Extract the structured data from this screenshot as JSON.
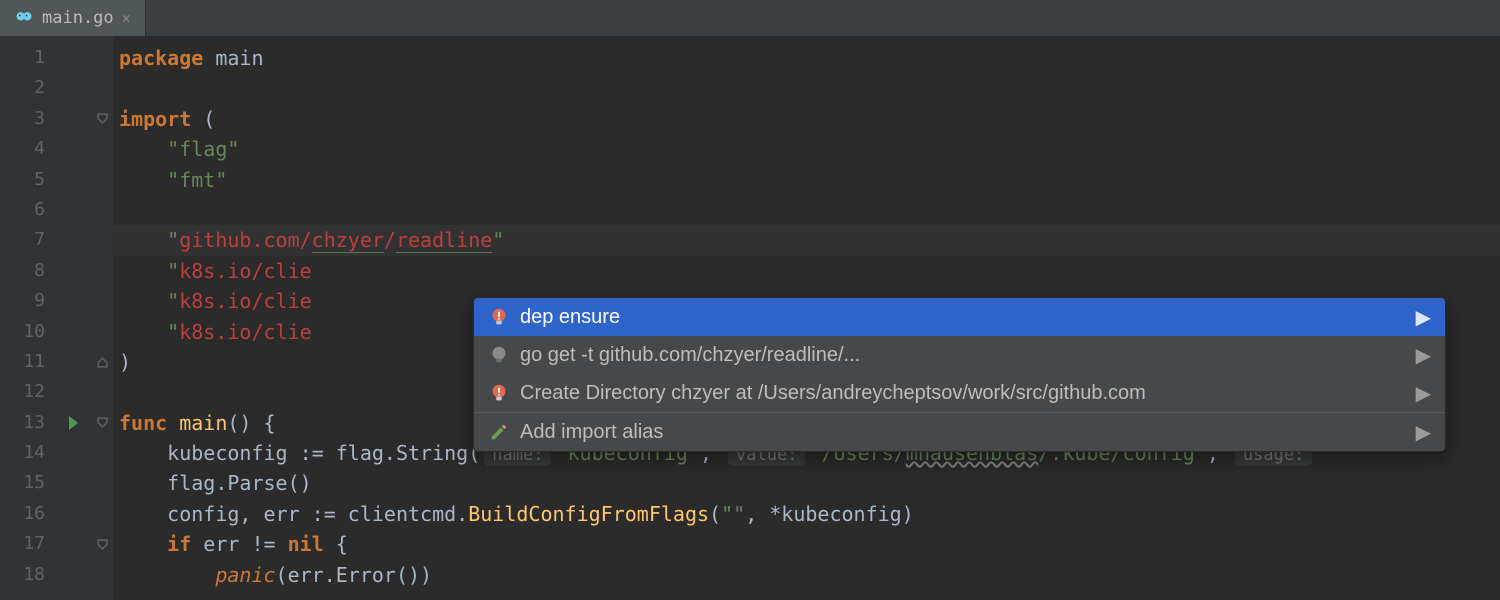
{
  "tab": {
    "filename": "main.go"
  },
  "gutter": {
    "start": 1,
    "end": 18
  },
  "run_marker_line": 13,
  "fold_markers": {
    "3": "open-top",
    "11": "open-bottom",
    "13": "open-top",
    "17": "open-top"
  },
  "bulb_line": 6,
  "highlighted_line": 7,
  "code": {
    "l1": {
      "pkg_kw": "package",
      "pkg_name": " main"
    },
    "l3": {
      "import_kw": "import",
      "paren": " ("
    },
    "l4": {
      "s": "\"flag\""
    },
    "l5": {
      "s": "\"fmt\""
    },
    "l7": {
      "q1": "\"",
      "p1": "github.com/",
      "p2": "chzyer",
      "slash": "/",
      "p3": "readline",
      "q2": "\""
    },
    "l8": {
      "q1": "\"",
      "a": "k8s.io/clie"
    },
    "l9": {
      "q1": "\"",
      "a": "k8s.io/clie"
    },
    "l10": {
      "q1": "\"",
      "a": "k8s.io/clie"
    },
    "l11": {
      "paren": ")"
    },
    "l13": {
      "func_kw": "func",
      "sp": " ",
      "fn": "main",
      "rest": "() {"
    },
    "l14": {
      "a": "kubeconfig ",
      "op": ":=",
      "b": " flag.String(",
      "h1": "name:",
      "s1": "\"kubeconfig\"",
      "c1": ",",
      "h2": "value:",
      "s2a": "\"/Users/",
      "s2b": "mhausenblas",
      "s2c": "/.kube/config\"",
      "c2": ",",
      "h3": "usage:"
    },
    "l15": {
      "a": "flag.Parse()"
    },
    "l16": {
      "a": "config, err ",
      "op": ":=",
      "b": " clientcmd.",
      "fn": "BuildConfigFromFlags",
      "c": "(",
      "s": "\"\"",
      "d": ", *kubeconfig)"
    },
    "l17": {
      "if_kw": "if",
      "a": " err != ",
      "nil_kw": "nil",
      "b": " {"
    },
    "l18": {
      "panic": "panic",
      "a": "(err.Error())"
    }
  },
  "popup": {
    "items": [
      {
        "icon": "bulb-red",
        "label": "dep ensure",
        "has_submenu": true,
        "selected": true
      },
      {
        "icon": "bulb-grey",
        "label": "go get -t github.com/chzyer/readline/...",
        "has_submenu": true,
        "selected": false
      },
      {
        "icon": "bulb-red",
        "label": "Create Directory chzyer at /Users/andreycheptsov/work/src/github.com",
        "has_submenu": true,
        "selected": false
      }
    ],
    "separator": true,
    "after": [
      {
        "icon": "pencil",
        "label": "Add import alias",
        "has_submenu": true,
        "selected": false
      }
    ]
  }
}
